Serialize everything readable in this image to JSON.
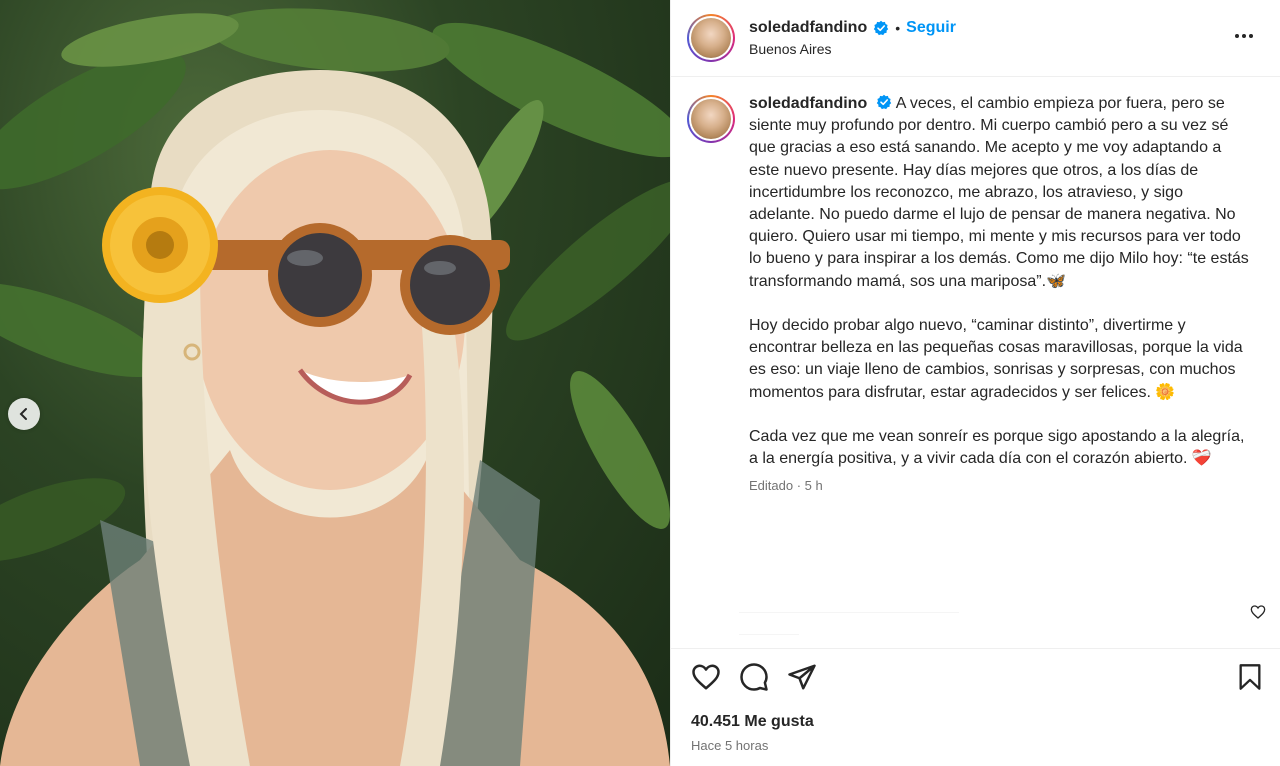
{
  "post": {
    "username": "soledadfandino",
    "follow_label": "Seguir",
    "separator": "•",
    "location": "Buenos Aires"
  },
  "caption": {
    "username": "soledadfandino",
    "text": "A veces, el cambio empieza por fuera, pero se siente muy profundo por dentro. Mi cuerpo cambió pero a su vez sé que gracias a eso está sanando. Me acepto y me voy adaptando a este nuevo presente. Hay días mejores que otros, a los días de incertidumbre los reconozco, me abrazo, los atravieso, y sigo adelante. No puedo darme el lujo de pensar de manera negativa. No quiero. Quiero usar mi tiempo, mi mente y mis recursos para ver todo lo bueno y para inspirar a los demás. Como me dijo Milo hoy: “te estás transformando mamá, sos una mariposa”.🦋\n\nHoy decido probar algo nuevo, “caminar distinto”, divertirme y encontrar belleza en las pequeñas cosas maravillosas, porque la vida es eso: un viaje lleno de cambios, sonrisas y sorpresas, con muchos momentos para disfrutar, estar agradecidos y ser felices. 🌼\n\nCada vez que me vean sonreír es porque sigo apostando a la alegría, a la energía positiva, y a vivir cada día con el corazón abierto. ❤️‍🩹",
    "meta": "Editado · 5 h"
  },
  "footer": {
    "likes": "40.451 Me gusta",
    "time_ago": "Hace 5 horas"
  },
  "colors": {
    "accent": "#0095f6",
    "text": "#262626",
    "muted": "#737373",
    "verified": "#0095f6"
  },
  "icons": {
    "more": "more-options-icon",
    "like": "heart-icon",
    "comment": "comment-icon",
    "share": "share-icon",
    "save": "bookmark-icon",
    "prev": "chevron-left-icon",
    "verified": "verified-badge-icon"
  }
}
